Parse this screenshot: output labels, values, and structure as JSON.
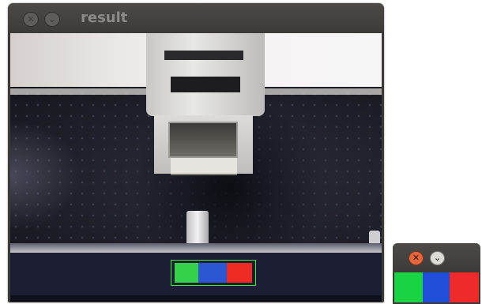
{
  "main_window": {
    "title": "result",
    "close_glyph": "✕",
    "menu_glyph": "⌄",
    "detected_colors": [
      "#34d14a",
      "#2c56d2",
      "#ee2b22"
    ],
    "detection_box_color": "#3ef03a"
  },
  "small_window": {
    "close_glyph": "✕",
    "menu_glyph": "⌄",
    "close_color": "#e2683f",
    "color_strip": [
      "#19d344",
      "#1f4fd8",
      "#ef2a2a"
    ]
  },
  "icons": {
    "close": "close-icon",
    "menu": "chevron-down-icon"
  }
}
